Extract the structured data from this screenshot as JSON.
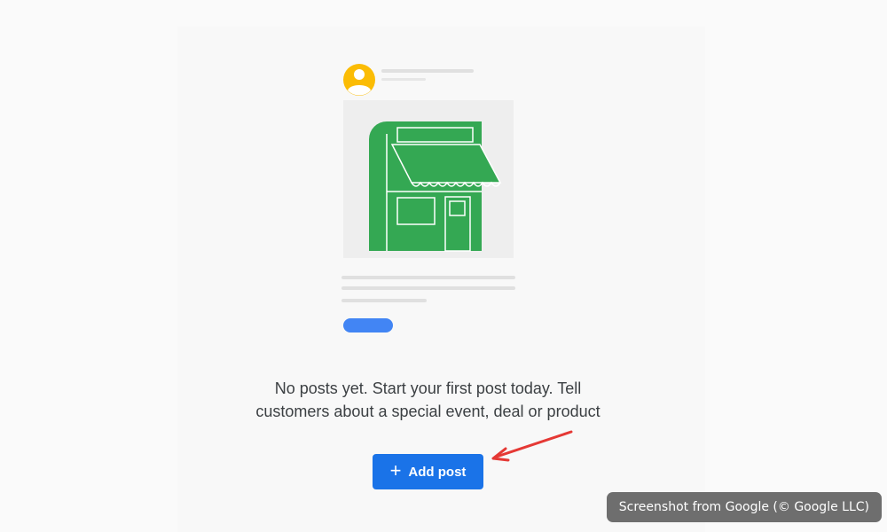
{
  "empty_state": {
    "message": "No posts yet. Start your first post today. Tell customers about a special event, deal or product",
    "message_line1": "No posts yet. Start your first post today. Tell",
    "message_line2": "customers about a special event, deal or product"
  },
  "actions": {
    "add_post_label": "Add post",
    "add_post_icon": "plus-icon"
  },
  "credit": {
    "text": "Screenshot from Google (© Google LLC)"
  },
  "colors": {
    "primary_button": "#1a73e8",
    "storefront_green": "#34a853",
    "avatar_yellow": "#fbbc04",
    "pill_blue": "#4285f4",
    "annotation_arrow": "#e53935",
    "credit_background": "#6e6e6e"
  }
}
